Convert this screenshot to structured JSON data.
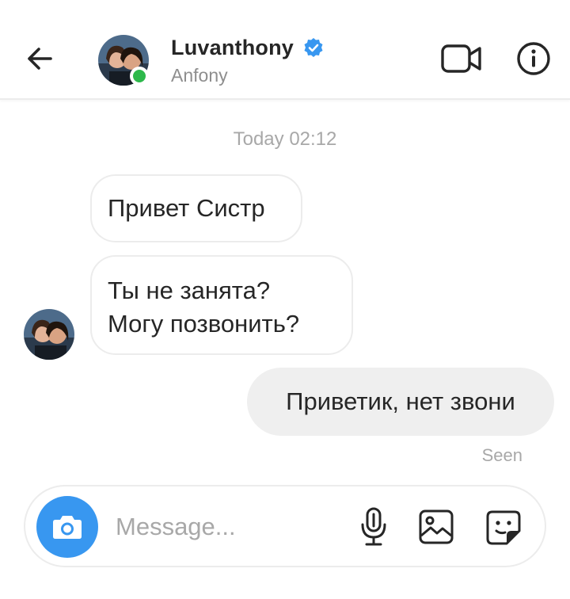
{
  "header": {
    "name": "Luvanthony",
    "subname": "Anfony",
    "verified": true,
    "online": true,
    "icons": [
      "back-arrow-icon",
      "verified-badge-icon",
      "video-call-icon",
      "info-icon"
    ]
  },
  "conversation": {
    "timestamp": "Today 02:12",
    "incoming": [
      {
        "lines": [
          "Привет Систр"
        ]
      },
      {
        "lines": [
          "Ты не занята?",
          "Могу позвонить?"
        ]
      }
    ],
    "outgoing": [
      {
        "text": "Приветик, нет звони"
      }
    ],
    "seen_label": "Seen"
  },
  "composer": {
    "placeholder": "Message...",
    "icons": [
      "camera-icon",
      "microphone-icon",
      "gallery-icon",
      "sticker-icon"
    ]
  },
  "colors": {
    "accent": "#3897f0",
    "online": "#2db84b",
    "outgoing_bubble": "#efefef",
    "muted_text": "#a8a8a8"
  }
}
